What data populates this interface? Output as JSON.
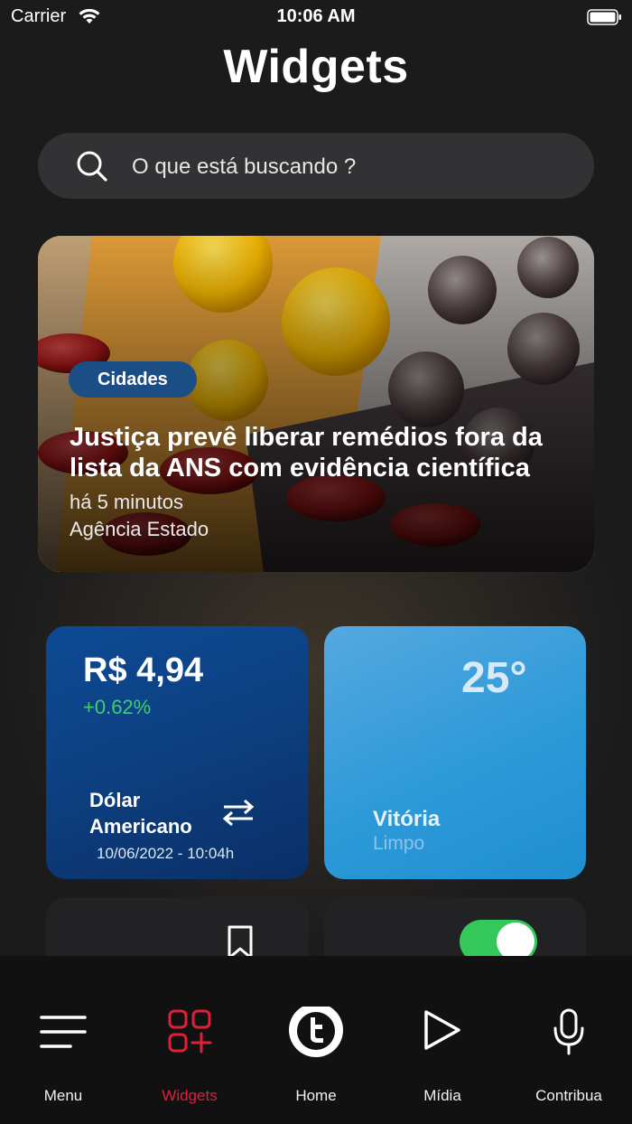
{
  "status_bar": {
    "carrier": "Carrier",
    "time": "10:06 AM"
  },
  "page": {
    "title": "Widgets"
  },
  "search": {
    "placeholder": "O que está buscando ?"
  },
  "news": {
    "category": "Cidades",
    "headline": "Justiça prevê liberar remédios fora da lista da ANS com evidência científica",
    "time": "há 5 minutos",
    "source": "Agência  Estado"
  },
  "currency": {
    "value": "R$ 4,94",
    "change": "+0.62%",
    "name": "Dólar Americano",
    "updated": "10/06/2022 - 10:04h",
    "change_color": "#3ed06a"
  },
  "weather": {
    "temperature": "25°",
    "city": "Vitória",
    "condition": "Limpo"
  },
  "toggle": {
    "on": true,
    "color": "#34c759"
  },
  "tabs": [
    {
      "label": "Menu",
      "icon": "menu-icon"
    },
    {
      "label": "Widgets",
      "icon": "widgets-icon",
      "active": true
    },
    {
      "label": "Home",
      "icon": "home-logo-icon"
    },
    {
      "label": "Mídia",
      "icon": "play-icon"
    },
    {
      "label": "Contribua",
      "icon": "microphone-icon"
    }
  ],
  "accent_color": "#e0203a"
}
